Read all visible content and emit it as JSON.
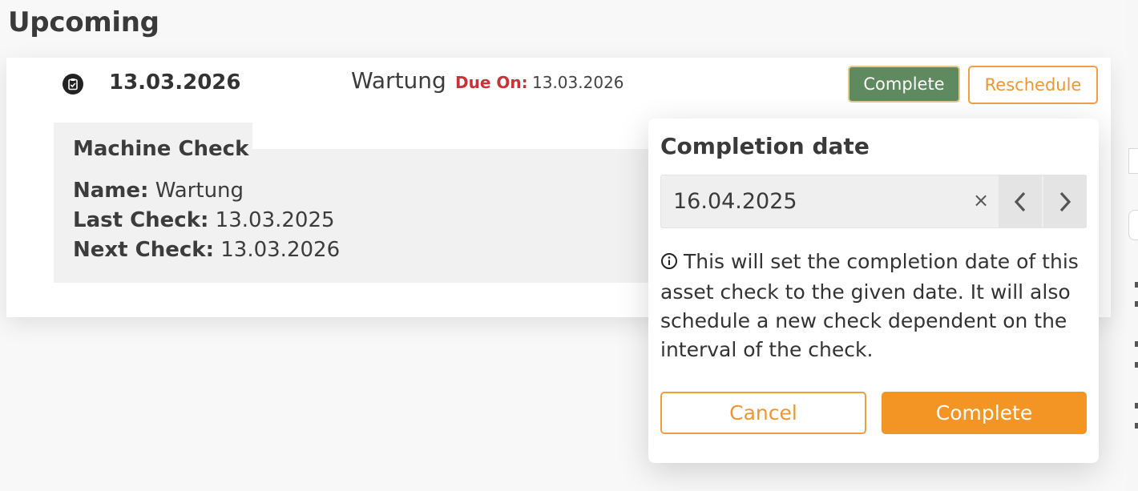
{
  "section": {
    "title": "Upcoming"
  },
  "check": {
    "date": "13.03.2026",
    "type": "Wartung",
    "due_label": "Due On:",
    "due_value": "13.03.2026",
    "actions": {
      "complete": "Complete",
      "reschedule": "Reschedule"
    },
    "icon": "clipboard-check-icon",
    "details": {
      "title": "Machine Check",
      "name_label": "Name:",
      "name_value": "Wartung",
      "last_label": "Last Check:",
      "last_value": "13.03.2025",
      "next_label": "Next Check:",
      "next_value": "13.03.2026"
    }
  },
  "popover": {
    "title": "Completion date",
    "date_value": "16.04.2025",
    "clear": "×",
    "icons": {
      "clear": "close-icon",
      "prev": "chevron-left-icon",
      "next": "chevron-right-icon",
      "info": "info-icon"
    },
    "info": "This will set the completion date of this asset check to the given date. It will also schedule a new check dependent on the interval of the check.",
    "cancel": "Cancel",
    "confirm": "Complete"
  },
  "colors": {
    "accent": "#f29525",
    "complete_green": "#5f8a60",
    "due_red": "#c8333a"
  }
}
